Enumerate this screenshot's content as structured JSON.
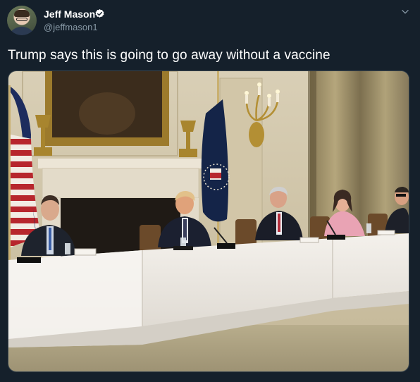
{
  "tweet": {
    "author_name": "Jeff Mason",
    "author_handle": "@jeffmason1",
    "verified": true,
    "text": "Trump says this is going to go away without a vaccine"
  },
  "icons": {
    "verified": "verified-badge-icon",
    "menu": "chevron-down-icon"
  },
  "colors": {
    "background": "#15202b",
    "text_primary": "#ffffff",
    "text_secondary": "#8899a6",
    "border": "#38444d"
  }
}
